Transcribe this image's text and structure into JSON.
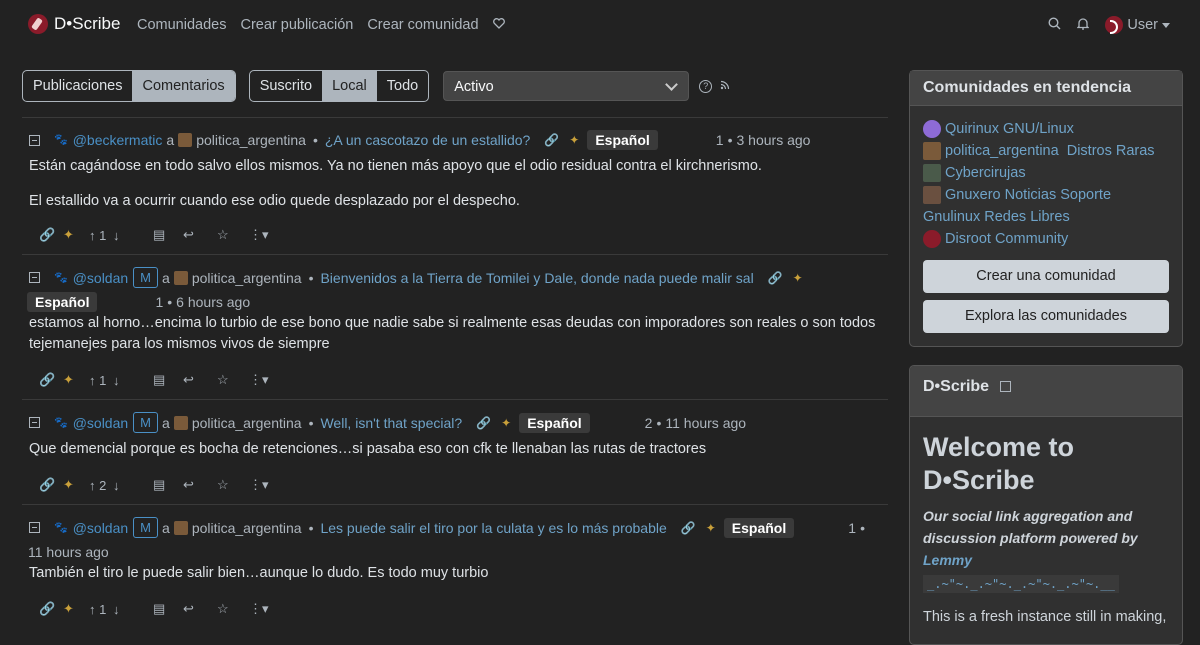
{
  "nav": {
    "brand": "D•Scribe",
    "links": [
      "Comunidades",
      "Crear publicación",
      "Crear comunidad"
    ],
    "user": "User"
  },
  "toolbar": {
    "type_options": [
      "Publicaciones",
      "Comentarios"
    ],
    "type_active": "Comentarios",
    "listing_options": [
      "Suscrito",
      "Local",
      "Todo"
    ],
    "listing_active": "Local",
    "sort": "Activo"
  },
  "comments": [
    {
      "user": "@beckermatic",
      "mod": "",
      "community": "politica_argentina",
      "post": "¿A un cascotazo de un estallido?",
      "language": "Español",
      "score": "1",
      "time": "3 hours ago",
      "paragraphs": [
        "Están cagándose en todo salvo ellos mismos. Ya no tienen más apoyo que el odio residual contra el kirchnerismo.",
        "El estallido va a ocurrir cuando ese odio quede desplazado por el despecho."
      ],
      "upvotes": "1"
    },
    {
      "user": "@soldan",
      "mod": "M",
      "community": "politica_argentina",
      "post": "Bienvenidos a la Tierra de Tomilei y Dale, donde nada puede malir sal",
      "language": "Español",
      "score": "1",
      "time": "6 hours ago",
      "paragraphs": [
        "estamos al horno…encima lo turbio de ese bono que nadie sabe si realmente esas deudas con imporadores son reales o son todos tejemanejes para los mismos vivos de siempre"
      ],
      "upvotes": "1"
    },
    {
      "user": "@soldan",
      "mod": "M",
      "community": "politica_argentina",
      "post": "Well, isn't that special?",
      "language": "Español",
      "score": "2",
      "time": "11 hours ago",
      "paragraphs": [
        "Que demencial porque es bocha de retenciones…si pasaba eso con cfk te llenaban las rutas de tractores"
      ],
      "upvotes": "2"
    },
    {
      "user": "@soldan",
      "mod": "M",
      "community": "politica_argentina",
      "post": "Les puede salir el tiro por la culata y es lo más probable",
      "language": "Español",
      "score": "1",
      "time": "11 hours ago",
      "paragraphs": [
        "También el tiro le puede salir bien…aunque lo dudo. Es todo muy turbio"
      ],
      "upvotes": "1"
    }
  ],
  "trending": {
    "title": "Comunidades en tendencia",
    "items": [
      "Quirinux GNU/Linux",
      "politica_argentina",
      "Distros Raras",
      "Cybercirujas",
      "Gnuxero Noticias Soporte",
      "Gnulinux Redes Libres",
      "Disroot Community"
    ],
    "create_btn": "Crear una comunidad",
    "explore_btn": "Explora las comunidades"
  },
  "site": {
    "name": "D•Scribe",
    "welcome": "Welcome to D•Scribe",
    "tagline_prefix": "Our social link aggregation and discussion platform powered by ",
    "tagline_link": "Lemmy",
    "ascii": "_.~\"~._.~\"~._.~\"~._.~\"~.__",
    "fresh": "This is a fresh instance still in making,"
  }
}
